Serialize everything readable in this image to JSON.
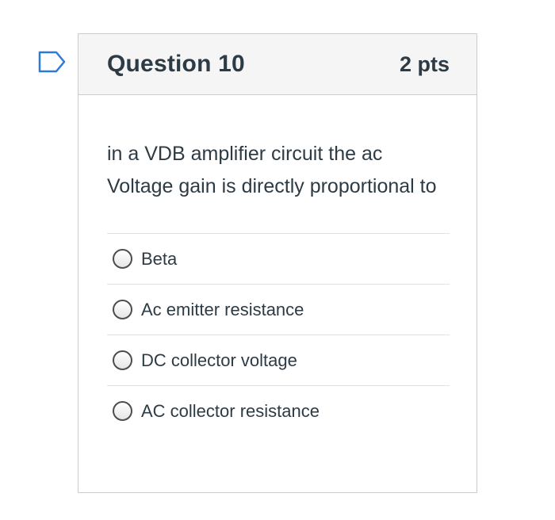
{
  "question": {
    "title": "Question 10",
    "points": "2 pts",
    "text": "in a VDB amplifier circuit the ac Voltage gain is directly proportional to"
  },
  "answers": [
    {
      "label": "Beta",
      "selected": false
    },
    {
      "label": "Ac emitter resistance",
      "selected": false
    },
    {
      "label": "DC collector voltage",
      "selected": false
    },
    {
      "label": "AC collector resistance",
      "selected": false
    }
  ],
  "icons": {
    "flag": "bookmark-flag-icon"
  },
  "colors": {
    "flag": "#2f7ad6",
    "text": "#2d3b45",
    "header_bg": "#f5f5f5",
    "border": "#c7cdd1"
  }
}
